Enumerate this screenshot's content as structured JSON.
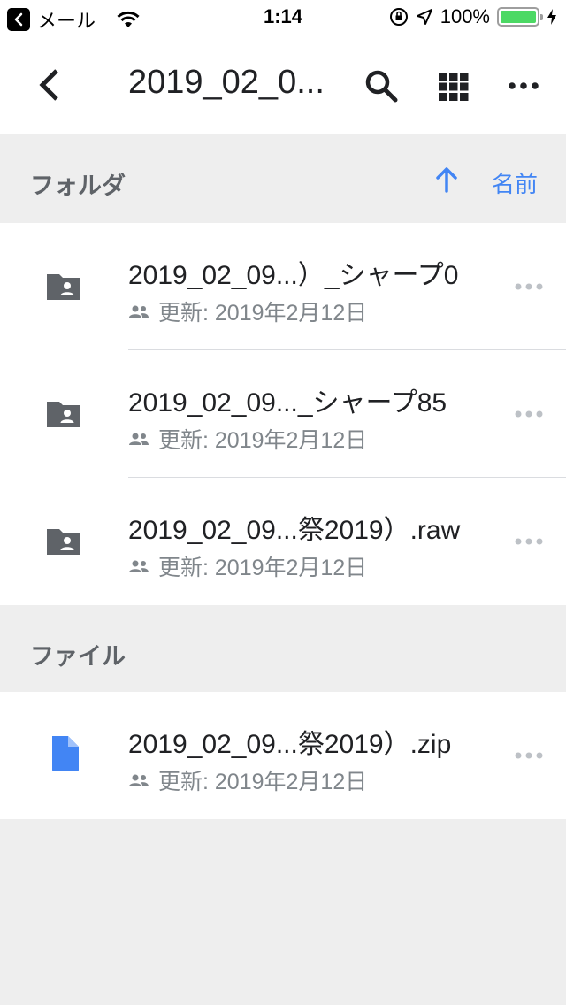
{
  "status_bar": {
    "back_app": "メール",
    "time": "1:14",
    "battery": "100%",
    "battery_level": 1.0
  },
  "header": {
    "title": "2019_02_0..."
  },
  "folders_section": {
    "title": "フォルダ",
    "sort_label": "名前"
  },
  "folders": [
    {
      "name": "2019_02_09...）_シャープ0",
      "modified": "更新: 2019年2月12日"
    },
    {
      "name": "2019_02_09..._シャープ85",
      "modified": "更新: 2019年2月12日"
    },
    {
      "name": "2019_02_09...祭2019）.raw",
      "modified": "更新: 2019年2月12日"
    }
  ],
  "files_section": {
    "title": "ファイル"
  },
  "files": [
    {
      "name": "2019_02_09...祭2019）.zip",
      "modified": "更新: 2019年2月12日"
    }
  ],
  "colors": {
    "accent": "#4285f4",
    "folder_icon": "#5f6368",
    "background": "#eeeeee"
  },
  "icons": {
    "back": "chevron-left-icon",
    "search": "search-icon",
    "grid": "grid-view-icon",
    "more": "more-horizontal-icon",
    "sort": "arrow-up-icon",
    "shared_folder": "shared-folder-icon",
    "file": "file-icon",
    "people": "people-icon"
  }
}
